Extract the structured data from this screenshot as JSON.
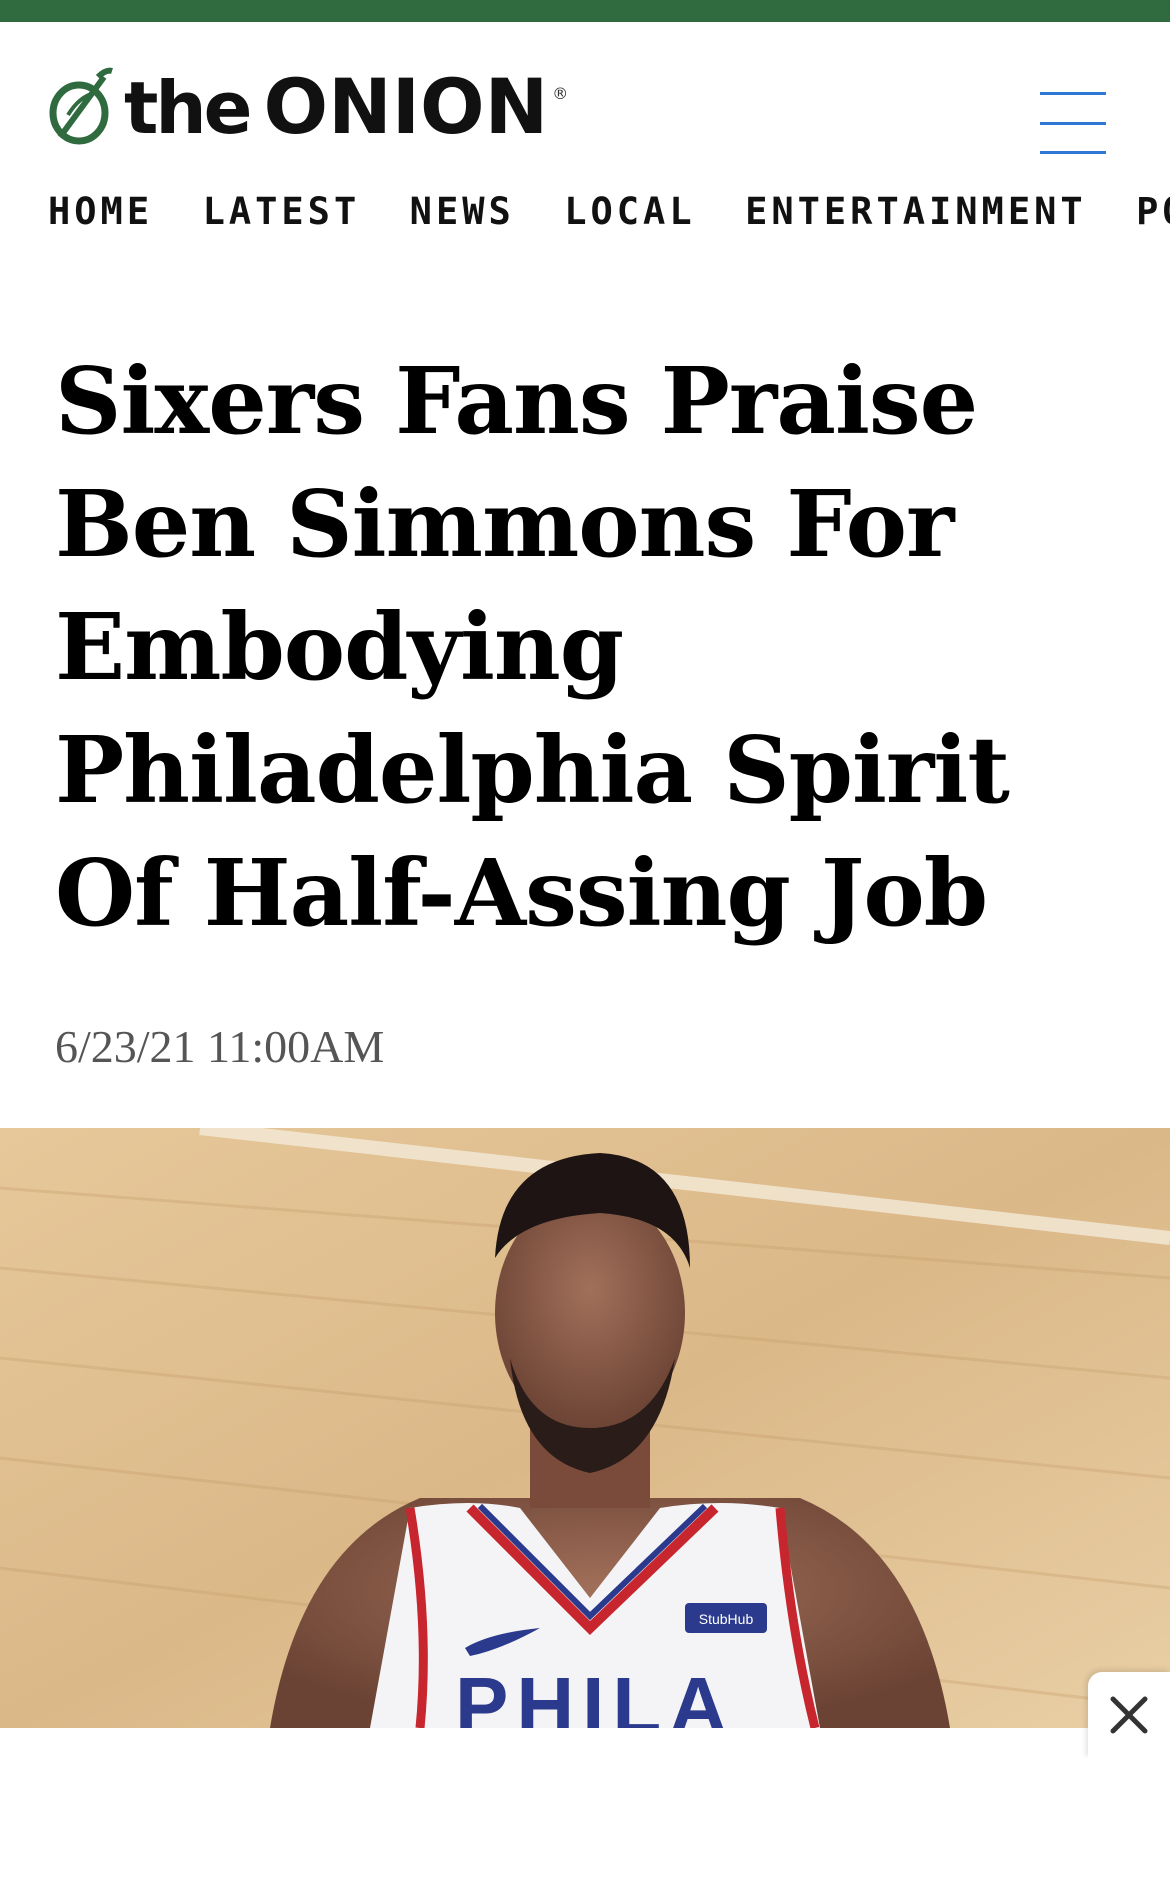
{
  "brand": {
    "name_prefix": "the",
    "name_main": "ONION",
    "registered": "®",
    "accent_color": "#2f6b3f",
    "menu_color": "#2c78d4"
  },
  "nav": {
    "items": [
      "HOME",
      "LATEST",
      "NEWS",
      "LOCAL",
      "ENTERTAINMENT",
      "POLITICS"
    ]
  },
  "article": {
    "headline_lines": [
      "Sixers Fans Praise",
      "Ben Simmons For",
      "Embodying",
      "Philadelphia Spirit",
      "Of Half-Assing Job"
    ],
    "timestamp": "6/23/21 11:00AM",
    "image": {
      "jersey_text": "PHILA",
      "patch_text": "StubHub"
    }
  },
  "icons": {
    "menu": "hamburger-menu-icon",
    "close": "close-icon",
    "logo": "onion-logo-icon"
  }
}
